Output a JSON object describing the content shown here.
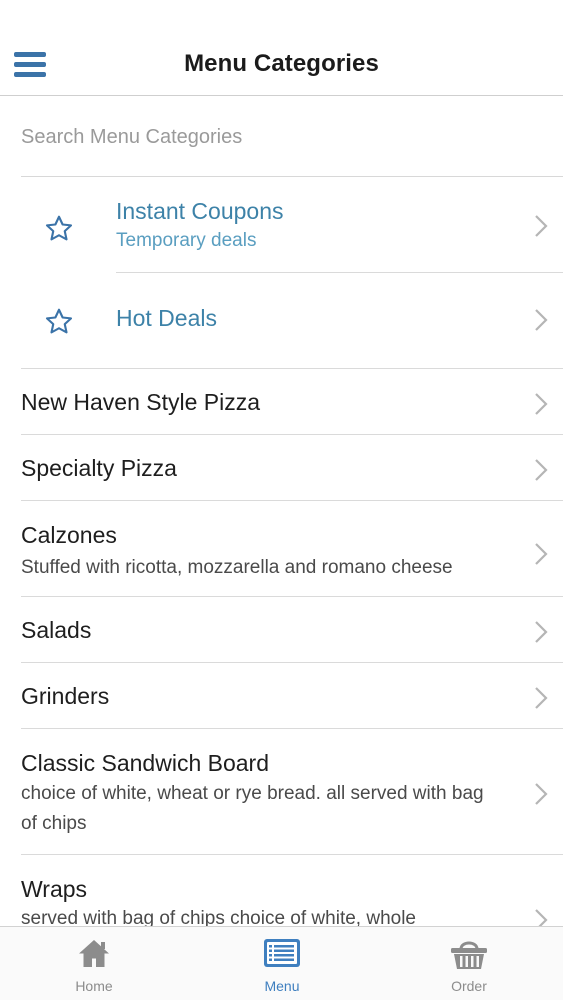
{
  "header": {
    "title": "Menu Categories",
    "menu_icon": "hamburger-menu-icon"
  },
  "search": {
    "placeholder": "Search Menu Categories",
    "value": ""
  },
  "featured": [
    {
      "title": "Instant Coupons",
      "subtitle": "Temporary deals",
      "icon": "star-icon"
    },
    {
      "title": "Hot Deals",
      "subtitle": "",
      "icon": "star-icon"
    }
  ],
  "categories": [
    {
      "title": "New Haven Style Pizza",
      "subtitle": ""
    },
    {
      "title": "Specialty Pizza",
      "subtitle": ""
    },
    {
      "title": "Calzones",
      "subtitle": "Stuffed with ricotta, mozzarella and romano cheese"
    },
    {
      "title": "Salads",
      "subtitle": ""
    },
    {
      "title": "Grinders",
      "subtitle": ""
    },
    {
      "title": "Classic Sandwich Board",
      "subtitle": "choice of white, wheat or rye bread. all served with bag of chips"
    },
    {
      "title": "Wraps",
      "subtitle": "served with bag of chips choice of white, whole"
    }
  ],
  "tabs": [
    {
      "label": "Home",
      "icon": "home-icon",
      "active": false
    },
    {
      "label": "Menu",
      "icon": "menu-list-icon",
      "active": true
    },
    {
      "label": "Order",
      "icon": "basket-icon",
      "active": false
    }
  ],
  "colors": {
    "accent": "#3b73a8",
    "featured_text": "#3d82a8",
    "featured_subtext": "#5a9ec0",
    "tab_active": "#3f7fbf",
    "tab_inactive": "#8c8c8c"
  }
}
